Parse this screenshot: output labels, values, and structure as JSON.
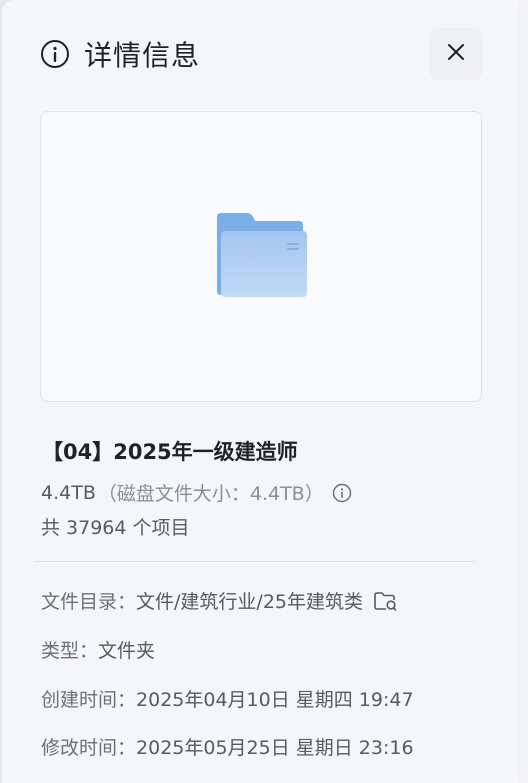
{
  "header": {
    "title": "详情信息"
  },
  "item": {
    "name": "【04】2025年一级建造师",
    "size": "4.4TB",
    "disk_size": "（磁盘文件大小：4.4TB）",
    "count": "共 37964 个项目"
  },
  "details": {
    "location_label": "文件目录：",
    "location_value": "文件/建筑行业/25年建筑类",
    "type_label": "类型：",
    "type_value": "文件夹",
    "created_label": "创建时间：",
    "created_value": "2025年04月10日 星期四 19:47",
    "modified_label": "修改时间：",
    "modified_value": "2025年05月25日 星期日 23:16"
  },
  "colors": {
    "accent_folder": "#8fb7ea",
    "text_primary": "#1f2329",
    "text_secondary": "#555a63"
  },
  "icons": [
    "info-icon",
    "close-icon",
    "folder-icon",
    "info-small-icon",
    "folder-location-icon"
  ]
}
